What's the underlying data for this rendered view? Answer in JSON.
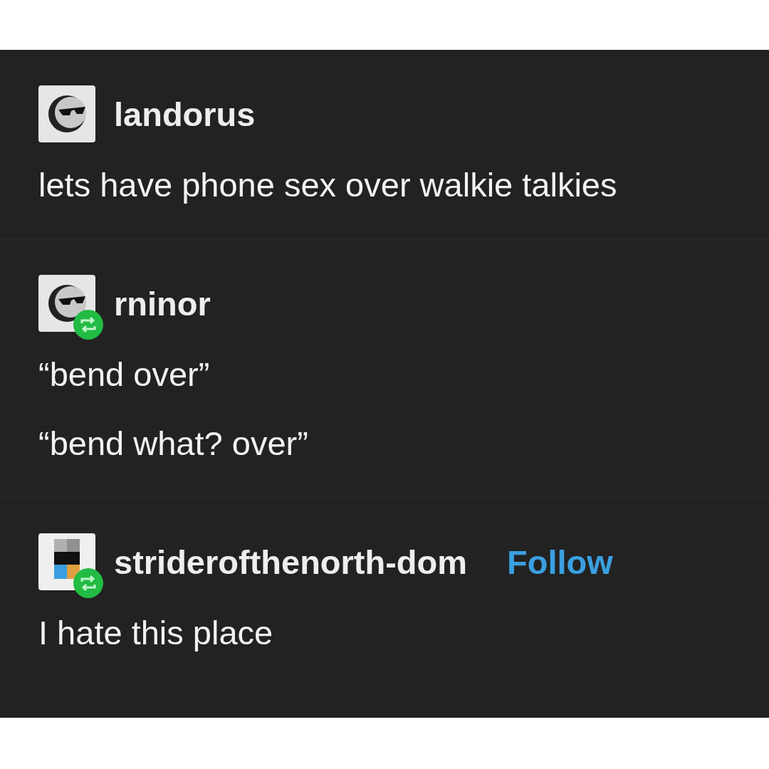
{
  "posts": [
    {
      "username": "landorus",
      "avatar": {
        "kind": "sunglasses"
      },
      "reblogged": false,
      "paragraphs": [
        "lets have phone sex over walkie talkies"
      ]
    },
    {
      "username": "rninor",
      "avatar": {
        "kind": "sunglasses"
      },
      "reblogged": true,
      "paragraphs": [
        "“bend over”",
        "“bend what? over”"
      ]
    },
    {
      "username": "striderofthenorth-dom",
      "avatar": {
        "kind": "blocks"
      },
      "reblogged": true,
      "follow": "Follow",
      "paragraphs": [
        "I hate this place"
      ]
    }
  ]
}
